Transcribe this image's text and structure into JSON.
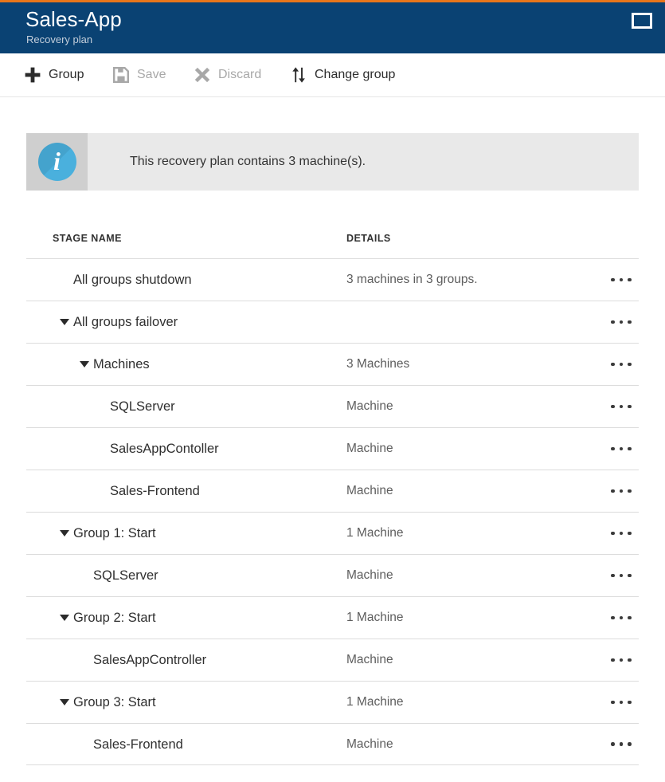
{
  "header": {
    "title": "Sales-App",
    "subtitle": "Recovery plan",
    "window_icon": "maximize-window-icon",
    "background_color": "#0a4273",
    "accent_color": "#e8761b"
  },
  "toolbar": {
    "items": [
      {
        "label": "Group",
        "icon": "plus-icon",
        "enabled": true
      },
      {
        "label": "Save",
        "icon": "save-floppy-icon",
        "enabled": false
      },
      {
        "label": "Discard",
        "icon": "close-x-icon",
        "enabled": false
      },
      {
        "label": "Change group",
        "icon": "sort-up-down-arrows-icon",
        "enabled": true
      }
    ]
  },
  "info_banner": {
    "icon": "info-circle-icon",
    "icon_color": "#4ab0dd",
    "message": "This recovery plan contains 3 machine(s)."
  },
  "table": {
    "columns": [
      "STAGE NAME",
      "DETAILS"
    ],
    "row_menu_icon": "ellipsis-icon",
    "rows": [
      {
        "name": "All groups shutdown",
        "details": "3 machines in 3 groups.",
        "level": 1,
        "expandable": false
      },
      {
        "name": "All groups failover",
        "details": "",
        "level": 1,
        "expandable": true
      },
      {
        "name": "Machines",
        "details": "3 Machines",
        "level": 2,
        "expandable": true
      },
      {
        "name": "SQLServer",
        "details": "Machine",
        "level": 3,
        "expandable": false
      },
      {
        "name": "SalesAppContoller",
        "details": "Machine",
        "level": 3,
        "expandable": false
      },
      {
        "name": "Sales-Frontend",
        "details": "Machine",
        "level": 3,
        "expandable": false
      },
      {
        "name": "Group 1: Start",
        "details": "1 Machine",
        "level": 1,
        "expandable": true
      },
      {
        "name": "SQLServer",
        "details": "Machine",
        "level": 2,
        "expandable": false
      },
      {
        "name": "Group 2: Start",
        "details": "1 Machine",
        "level": 1,
        "expandable": true
      },
      {
        "name": "SalesAppController",
        "details": "Machine",
        "level": 2,
        "expandable": false
      },
      {
        "name": "Group 3: Start",
        "details": "1 Machine",
        "level": 1,
        "expandable": true
      },
      {
        "name": "Sales-Frontend",
        "details": "Machine",
        "level": 2,
        "expandable": false
      }
    ]
  }
}
